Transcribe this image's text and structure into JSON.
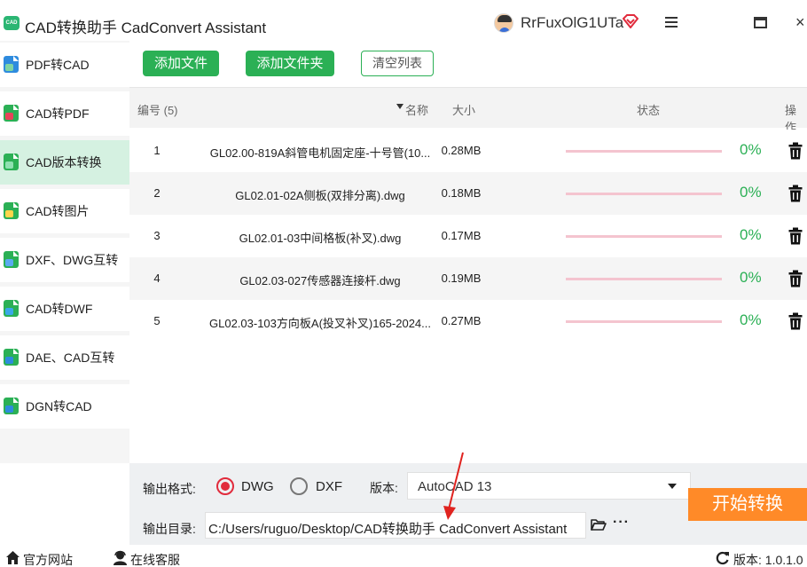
{
  "titlebar": {
    "logo_text": "CAD",
    "title": "CAD转换助手 CadConvert Assistant",
    "username": "RrFuxOlG1UTa"
  },
  "sidebar": {
    "items": [
      {
        "label": "PDF转CAD",
        "icon": "pdf-to-cad-icon",
        "active": false
      },
      {
        "label": "CAD转PDF",
        "icon": "cad-to-pdf-icon",
        "active": false
      },
      {
        "label": "CAD版本转换",
        "icon": "cad-version-icon",
        "active": true
      },
      {
        "label": "CAD转图片",
        "icon": "cad-to-image-icon",
        "active": false
      },
      {
        "label": "DXF、DWG互转",
        "icon": "dxf-dwg-icon",
        "active": false
      },
      {
        "label": "CAD转DWF",
        "icon": "cad-to-dwf-icon",
        "active": false
      },
      {
        "label": "DAE、CAD互转",
        "icon": "dae-cad-icon",
        "active": false
      },
      {
        "label": "DGN转CAD",
        "icon": "dgn-to-cad-icon",
        "active": false
      }
    ]
  },
  "toolbar": {
    "add_file": "添加文件",
    "add_folder": "添加文件夹",
    "clear_list": "清空列表"
  },
  "table": {
    "headers": {
      "number": "编号 (5)",
      "name": "名称",
      "size": "大小",
      "status": "状态",
      "action": "操作"
    },
    "rows": [
      {
        "number": "1",
        "name": "GL02.00-819A斜管电机固定座-十号管(10...",
        "size": "0.28MB",
        "progress": 0,
        "percent": "0%"
      },
      {
        "number": "2",
        "name": "GL02.01-02A侧板(双排分离).dwg",
        "size": "0.18MB",
        "progress": 0,
        "percent": "0%"
      },
      {
        "number": "3",
        "name": "GL02.01-03中间格板(补叉).dwg",
        "size": "0.17MB",
        "progress": 0,
        "percent": "0%"
      },
      {
        "number": "4",
        "name": "GL02.03-027传感器连接杆.dwg",
        "size": "0.19MB",
        "progress": 0,
        "percent": "0%"
      },
      {
        "number": "5",
        "name": "GL02.03-103方向板A(投叉补叉)165-2024...",
        "size": "0.27MB",
        "progress": 0,
        "percent": "0%"
      }
    ]
  },
  "output": {
    "format_label": "输出格式:",
    "format_options": [
      "DWG",
      "DXF"
    ],
    "format_selected": "DWG",
    "version_label": "版本:",
    "version_value": "AutoCAD 13",
    "dir_label": "输出目录:",
    "dir_value": "C:/Users/ruguo/Desktop/CAD转换助手 CadConvert Assistant",
    "more": "···",
    "start_button": "开始转换"
  },
  "statusbar": {
    "website": "官方网站",
    "support": "在线客服",
    "version": "版本: 1.0.1.0"
  },
  "colors": {
    "accent_green": "#2bb055",
    "active_bg": "#d5f1e1",
    "start_orange": "#ff8a28",
    "radio_red": "#e12b3c",
    "progress_track": "#f4c4cf"
  }
}
